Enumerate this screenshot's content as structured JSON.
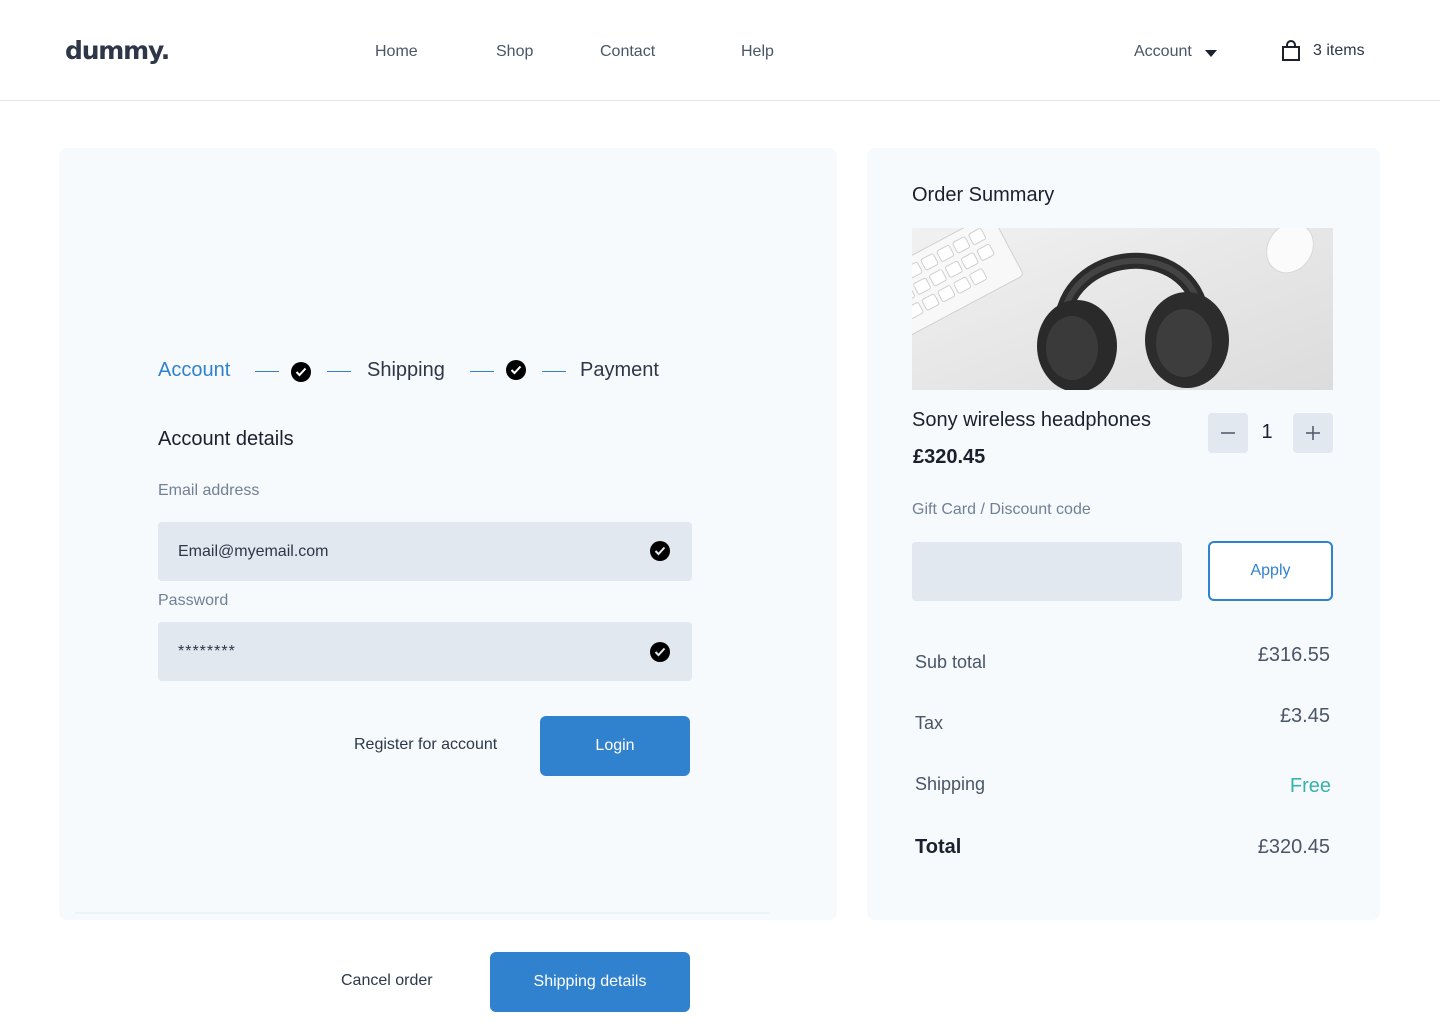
{
  "header": {
    "logo": "dummy.",
    "nav": [
      "Home",
      "Shop",
      "Contact",
      "Help"
    ],
    "account_label": "Account",
    "cart_label": "3 items"
  },
  "steps": {
    "account": "Account",
    "shipping": "Shipping",
    "payment": "Payment"
  },
  "account_form": {
    "title": "Account details",
    "email_label": "Email address",
    "email_value": "Email@myemail.com",
    "password_label": "Password",
    "password_value": "********",
    "register_label": "Register for account",
    "login_label": "Login"
  },
  "footer_actions": {
    "cancel_label": "Cancel order",
    "next_label": "Shipping details"
  },
  "order_summary": {
    "title": "Order Summary",
    "product_name": "Sony wireless headphones",
    "product_price": "£320.45",
    "quantity": "1",
    "discount_label": "Gift Card / Discount code",
    "discount_placeholder": "",
    "apply_label": "Apply",
    "subtotal_label": "Sub total",
    "subtotal_value": "£316.55",
    "tax_label": "Tax",
    "tax_value": "£3.45",
    "shipping_label": "Shipping",
    "shipping_value": "Free",
    "total_label": "Total",
    "total_value": "£320.45"
  },
  "colors": {
    "accent": "#3182ce",
    "free": "#38b2ac",
    "panel": "#f7fafc",
    "input": "#e2e8f0"
  }
}
